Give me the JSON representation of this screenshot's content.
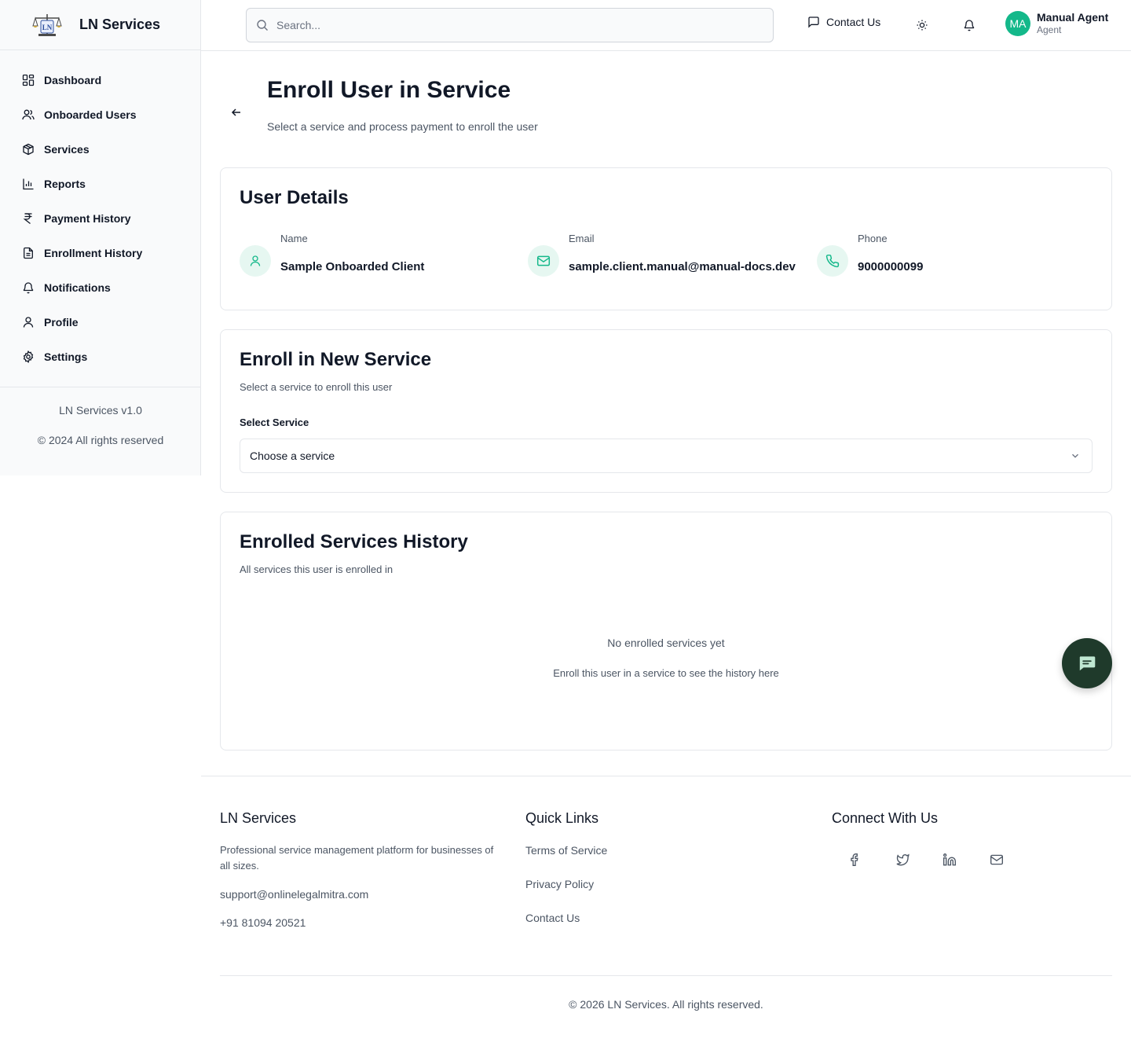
{
  "app": {
    "brand": "LN Services"
  },
  "sidebar": {
    "items": [
      {
        "label": "Dashboard",
        "icon": "dashboard-icon"
      },
      {
        "label": "Onboarded Users",
        "icon": "users-icon"
      },
      {
        "label": "Services",
        "icon": "package-icon"
      },
      {
        "label": "Reports",
        "icon": "bar-chart-icon"
      },
      {
        "label": "Payment History",
        "icon": "rupee-icon"
      },
      {
        "label": "Enrollment History",
        "icon": "file-text-icon"
      },
      {
        "label": "Notifications",
        "icon": "bell-icon"
      },
      {
        "label": "Profile",
        "icon": "user-icon"
      },
      {
        "label": "Settings",
        "icon": "gear-icon"
      }
    ],
    "version": "LN Services v1.0",
    "copyright": "© 2024 All rights reserved"
  },
  "header": {
    "search_placeholder": "Search...",
    "contact_label": "Contact Us",
    "user": {
      "initials": "MA",
      "name": "Manual Agent",
      "role": "Agent"
    }
  },
  "page": {
    "title": "Enroll User in Service",
    "subtitle": "Select a service and process payment to enroll the user"
  },
  "user_details": {
    "title": "User Details",
    "name_label": "Name",
    "name_value": "Sample Onboarded Client",
    "email_label": "Email",
    "email_value": "sample.client.manual@manual-docs.dev",
    "phone_label": "Phone",
    "phone_value": "9000000099"
  },
  "enroll": {
    "title": "Enroll in New Service",
    "subtitle": "Select a service to enroll this user",
    "field_label": "Select Service",
    "select_value": "Choose a service"
  },
  "history": {
    "title": "Enrolled Services History",
    "subtitle": "All services this user is enrolled in",
    "empty_title": "No enrolled services yet",
    "empty_sub": "Enroll this user in a service to see the history here"
  },
  "footer": {
    "brand": "LN Services",
    "description": "Professional service management platform for businesses of all sizes.",
    "email": "support@onlinelegalmitra.com",
    "phone": "+91 81094 20521",
    "quick_links_title": "Quick Links",
    "links": [
      "Terms of Service",
      "Privacy Policy",
      "Contact Us"
    ],
    "connect_title": "Connect With Us",
    "socials": [
      "facebook-icon",
      "twitter-icon",
      "linkedin-icon",
      "mail-icon"
    ],
    "copyright": "© 2026 LN Services. All rights reserved."
  },
  "colors": {
    "accent": "#14b88a",
    "accent_soft": "#e6f7f1",
    "fab": "#1f3a2b"
  }
}
